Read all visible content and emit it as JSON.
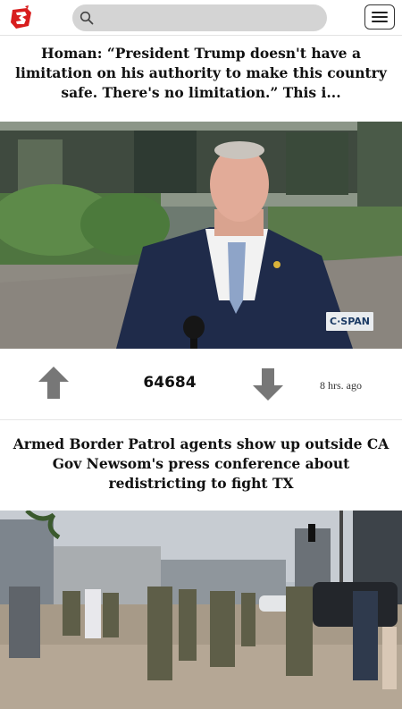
{
  "header": {
    "logo_icon": "site-logo-icon",
    "search_icon": "search-icon",
    "search_placeholder": "",
    "menu_icon": "hamburger-menu-icon"
  },
  "stories": [
    {
      "headline": "Homan: “President Trump doesn't have a limitation on his authority to make this country safe. There's no limitation.” This i...",
      "image_watermark": "C·SPAN",
      "votes": "64684",
      "time_ago": "8 hrs. ago",
      "upvote_icon": "arrow-up-icon",
      "downvote_icon": "arrow-down-icon"
    },
    {
      "headline": "Armed Border Patrol agents show up outside CA Gov Newsom's press conference about redistricting to fight TX"
    }
  ],
  "colors": {
    "logo_red": "#d81d1d",
    "icon_gray": "#777777",
    "search_bg": "#d4d4d4"
  }
}
